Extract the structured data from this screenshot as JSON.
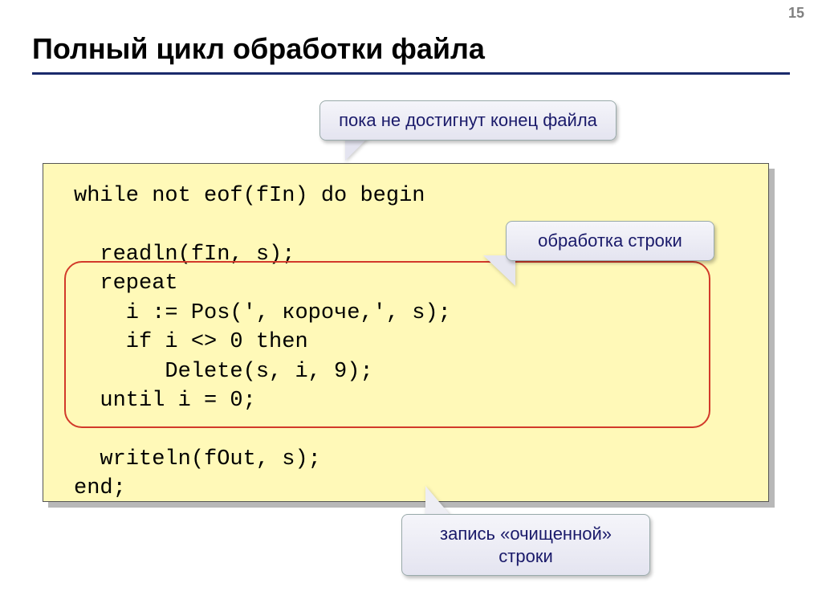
{
  "pageNumber": "15",
  "title": "Полный цикл обработки файла",
  "callouts": {
    "top": "пока не достигнут конец файла",
    "right": "обработка строки",
    "bottom": "запись «очищенной»\nстроки"
  },
  "code": {
    "line1": "while not eof(fIn) do begin",
    "line2": "  readln(fIn, s);",
    "line3": "  repeat",
    "line4": "    i := Pos(', короче,', s);",
    "line5": "    if i <> 0 then",
    "line6": "       Delete(s, i, 9);",
    "line7": "  until i = 0;",
    "line8": "  writeln(fOut, s);",
    "line9": "end;"
  }
}
